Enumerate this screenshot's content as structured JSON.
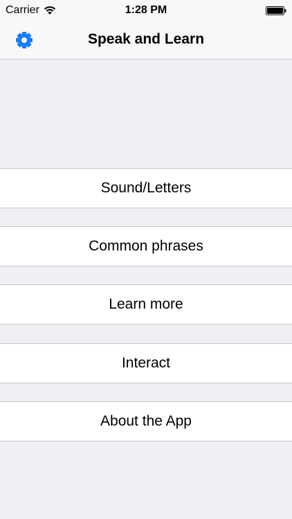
{
  "status_bar": {
    "carrier": "Carrier",
    "time": "1:28 PM"
  },
  "nav": {
    "title": "Speak and Learn",
    "settings_icon": "gear-icon",
    "accent_color": "#1a7cf5"
  },
  "menu": {
    "items": [
      {
        "label": "Sound/Letters"
      },
      {
        "label": "Common phrases"
      },
      {
        "label": "Learn more"
      },
      {
        "label": "Interact"
      },
      {
        "label": "About the App"
      }
    ]
  }
}
